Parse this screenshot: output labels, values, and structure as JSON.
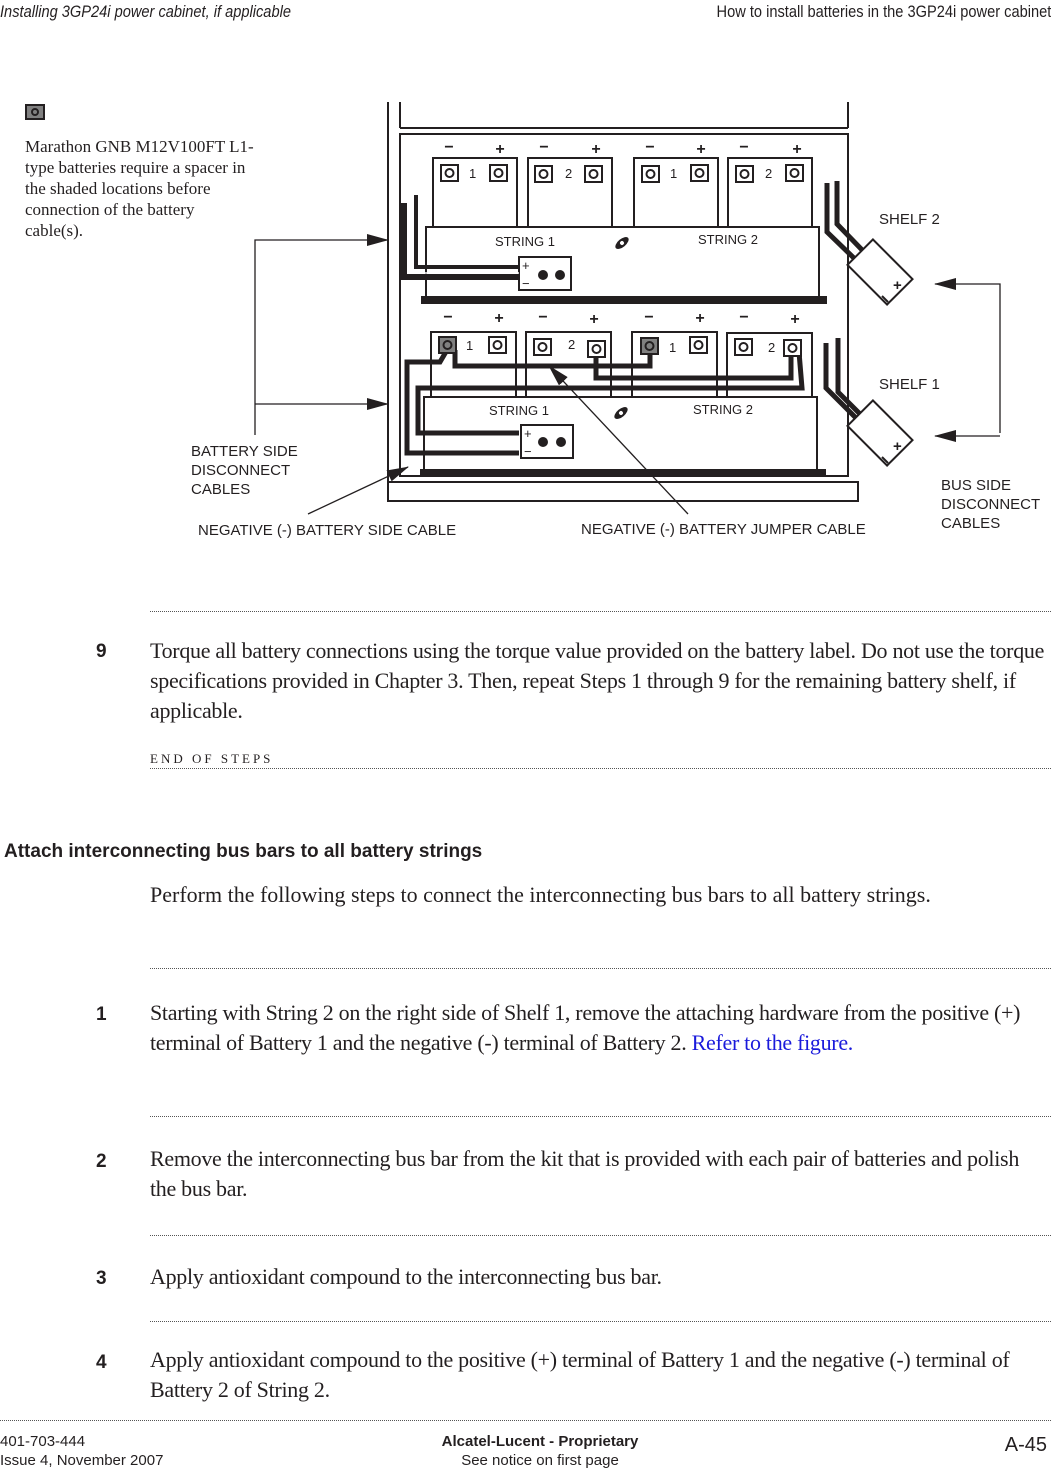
{
  "header": {
    "left": "Installing 3GP24i power cabinet, if applicable",
    "right": "How to install batteries in the 3GP24i power cabinet"
  },
  "figure": {
    "spacer_icon": "shaded-terminal-icon",
    "note": "Marathon GNB M12V100FT L1-type batteries require a spacer in the shaded locations before connection of the battery cable(s).",
    "shelf2_label": "SHELF 2",
    "shelf1_label": "SHELF 1",
    "string1_label": "STRING 1",
    "string2_label": "STRING 2",
    "battery_numbers": [
      "1",
      "2",
      "1",
      "2"
    ],
    "terminal_minus": "−",
    "terminal_plus": "+",
    "battery_side_label": [
      "BATTERY SIDE",
      "DISCONNECT",
      "CABLES"
    ],
    "bus_side_label": [
      "BUS SIDE",
      "DISCONNECT",
      "CABLES"
    ],
    "neg_side_cable_label": "NEGATIVE (-) BATTERY SIDE CABLE",
    "neg_jumper_cable_label": "NEGATIVE (-) BATTERY JUMPER CABLE"
  },
  "steps_a": [
    {
      "num": "9",
      "text": "Torque all battery connections using the torque value provided on the battery label. Do not use the torque specifications provided in Chapter 3. Then, repeat Steps 1 through 9 for the remaining battery shelf, if applicable."
    }
  ],
  "end_of_steps": "END OF STEPS",
  "section": {
    "title": "Attach interconnecting bus bars to all battery strings",
    "intro": "Perform the following steps to connect the interconnecting bus bars to all battery strings."
  },
  "steps_b": [
    {
      "num": "1",
      "text": "Starting with String 2 on the right side of Shelf 1, remove the attaching hardware from the positive (+) terminal of Battery 1 and the negative (-) terminal of Battery 2.",
      "link": "Refer to the figure."
    },
    {
      "num": "2",
      "text": "Remove the interconnecting bus bar from the kit that is provided with each pair of batteries and polish the bus bar."
    },
    {
      "num": "3",
      "text": "Apply antioxidant compound to the interconnecting bus bar."
    },
    {
      "num": "4",
      "text": "Apply antioxidant compound to the positive (+) terminal of Battery 1 and the negative (-) terminal of Battery 2 of String 2."
    }
  ],
  "footer": {
    "doc_number": "401-703-444",
    "issue": "Issue 4, November 2007",
    "proprietary": "Alcatel-Lucent - Proprietary",
    "notice": "See notice on first page",
    "page": "A-45"
  }
}
